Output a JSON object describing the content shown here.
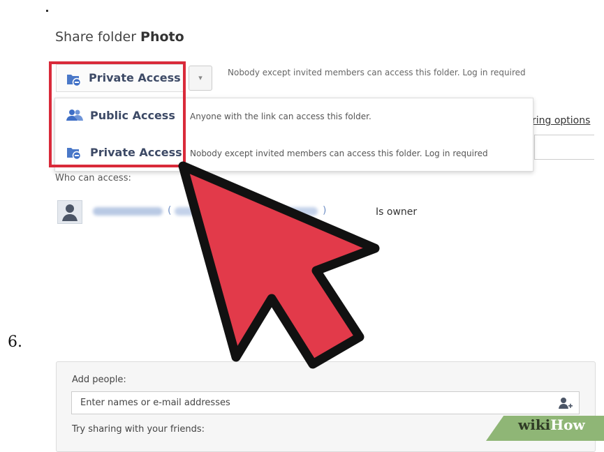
{
  "dialog": {
    "title_prefix": "Share folder",
    "folder_name": "Photo",
    "access_selected": "Private Access",
    "access_hint": "Nobody except invited members can access this folder. Log in required",
    "menu": [
      {
        "label": "Public Access",
        "description": "Anyone with the link can access this folder."
      },
      {
        "label": "Private Access",
        "description": "Nobody except invited members can access this folder. Log in required"
      }
    ],
    "sharing_options_link": "ring options",
    "who_can_access_label": "Who can access:",
    "member_role": "Is owner"
  },
  "step_number": "6.",
  "add_people": {
    "label": "Add people:",
    "input_placeholder": "Enter names or e-mail addresses",
    "try_label": "Try sharing with your friends:"
  },
  "watermark": {
    "wiki": "wiki",
    "how": "How"
  },
  "colors": {
    "highlight_red": "#d92a3a",
    "cursor_red": "#e23a4a",
    "icon_blue": "#3f6fc6",
    "watermark_green": "#8fb676"
  },
  "icons": [
    "folder-lock-icon",
    "people-icon",
    "user-avatar-icon",
    "add-user-icon",
    "dropdown-caret-icon",
    "mouse-cursor-arrow"
  ]
}
